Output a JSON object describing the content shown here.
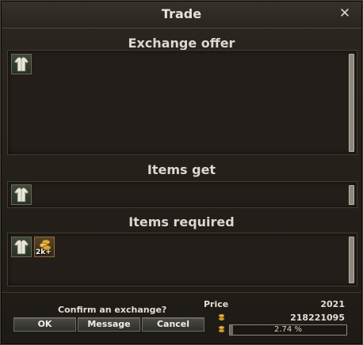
{
  "window": {
    "title": "Trade",
    "close_icon": "close-icon"
  },
  "sections": {
    "exchange_offer": "Exchange offer",
    "items_get": "Items get",
    "items_required": "Items required"
  },
  "items": {
    "offer": [
      {
        "icon": "shirt-icon"
      }
    ],
    "get": [
      {
        "icon": "shirt-icon"
      }
    ],
    "required": [
      {
        "icon": "shirt-icon"
      },
      {
        "icon": "gold-coins-icon",
        "badge": "2k+"
      }
    ]
  },
  "footer": {
    "confirm_text": "Confirm an exchange?",
    "buttons": {
      "ok": "OK",
      "message": "Message",
      "cancel": "Cancel"
    },
    "price_label": "Price",
    "price_value": "2021",
    "gold_total": "218221095",
    "progress_text": "2.74 %",
    "progress_fraction": 0.0274
  },
  "colors": {
    "background": "#2b2620",
    "panel": "#231e19",
    "accent_gold": "#d6a23a"
  }
}
